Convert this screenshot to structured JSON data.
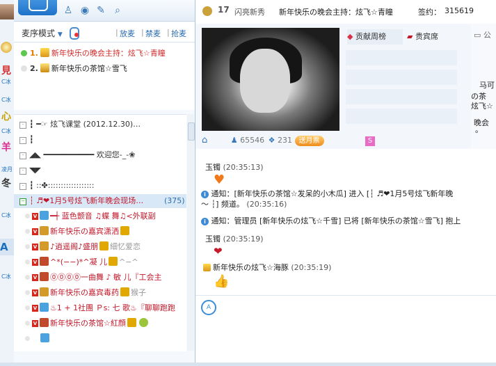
{
  "left_strip": {
    "chars": [
      "影",
      "見",
      "心",
      "亻",
      "心",
      "冬",
      "羊",
      "C冰",
      "C冰"
    ],
    "tiny": [
      "C冰",
      "C冰",
      "C冰",
      "凌月"
    ],
    "bar_letter": "A"
  },
  "toolbar": {
    "icons": [
      "user-icon",
      "location-icon",
      "edit-icon",
      "search-icon"
    ]
  },
  "mode": {
    "label": "麦序模式",
    "actions": [
      "放麦",
      "禁麦",
      "抢麦"
    ]
  },
  "mic_queue": [
    {
      "num": "1.",
      "name": "新年快乐の晚会主持：炫飞☆青瞳"
    },
    {
      "num": "2.",
      "name": "新年快乐の茶馆☆雪飞"
    }
  ],
  "channel_tree": {
    "rows": [
      {
        "box": "·",
        "text": "┇    ━☞  炫飞课堂 (2012.12.30)…"
      },
      {
        "box": "·",
        "text": "┇"
      },
      {
        "box": "·",
        "text": "◢◣ ━━━━━━━━━━━  欢迎您-_-❀"
      },
      {
        "box": "·",
        "text": "◥◤"
      },
      {
        "box": "·",
        "text": "┇              ::✤::::::::::::::::::"
      },
      {
        "box": "−",
        "text": "┆ ♬❤1月5号炫飞新年晚会现场…",
        "count": "(375)"
      }
    ],
    "users": [
      "━┽ 蓝色颤音 ♫蝶  舞♫<外联副",
      "新年快乐の嘉宾潇洒",
      "♪逍遥阁♪盛朋",
      "^*(−−)*^凝  儿",
      "⓪⓪⓪⓪一曲舞 ♪ 敏  儿『工会主",
      "新年快乐の嘉宾毒药",
      "♨1 + 1社團 Ｐs: 七  歌♨『聊聊跑跑",
      "新年快乐の茶馆☆紅顔",
      ""
    ],
    "user_extras": [
      "",
      "",
      "細忆爱恋",
      "^−^",
      "",
      "猴子",
      "",
      "",
      ""
    ]
  },
  "header": {
    "level": "17",
    "rank": "闪亮新秀",
    "host": "新年快乐の晚会主持：炫飞☆青瞳",
    "sign_label": "签约：",
    "sign_id": "315619"
  },
  "anchor": {
    "fans": "65546",
    "flowers": "231",
    "gift_button": "送月票",
    "s_label": "S"
  },
  "rank_tabs": [
    "贡献周榜",
    "贵宾席"
  ],
  "notice_panel": {
    "title": "公",
    "lines": [
      "马可",
      "の茶",
      "炫飞☆",
      "晚会",
      "。"
    ]
  },
  "chat": [
    {
      "type": "name",
      "user": "玉镯",
      "time": "(20:35:13)"
    },
    {
      "type": "notice",
      "text": "通知：[新年快乐の茶馆☆发呆的小木瓜] 进入 [┆ ♬❤1月5号炫飞新年晚",
      "text2": "～ ┆] 频道。",
      "time": "(20:35:16)"
    },
    {
      "type": "notice",
      "text": "通知：管理员 [新年快乐の炫飞☆千雪] 已将 [新年快乐の茶馆☆雪飞] 抱上"
    },
    {
      "type": "name",
      "user": "玉镯",
      "time": "(20:35:19)"
    },
    {
      "type": "name",
      "user": "新年快乐の炫飞☆海豚",
      "time": "(20:35:19)"
    }
  ],
  "colors": {
    "accent": "#1f72c8",
    "link": "#2b6cb0",
    "gift": "#ee8d1d",
    "highlight": "#d9e8f7"
  }
}
